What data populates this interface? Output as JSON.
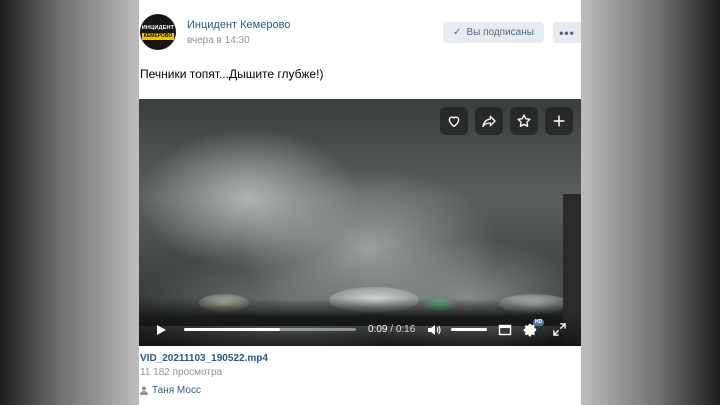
{
  "post": {
    "author": "Инцидент Кемерово",
    "avatar_line1": "ИНЦИДЕНТ",
    "avatar_line2": "КЕМЕРОВО",
    "time": "вчера в 14:30",
    "subscribe_label": "Вы подписаны",
    "more_label": "•••",
    "text": "Печники топят...Дышите глубже!)"
  },
  "video": {
    "current_time": "0:09",
    "separator": " / ",
    "duration": "0:16",
    "progress_fraction": 0.56,
    "volume_fraction": 1.0,
    "quality_badge": "HD",
    "top_controls": [
      "heart-icon",
      "share-icon",
      "star-icon",
      "plus-icon"
    ],
    "bottom_controls": [
      "play-icon",
      "volume-icon",
      "miniplayer-icon",
      "gear-icon",
      "fullscreen-icon"
    ]
  },
  "attachment": {
    "file_name": "VID_20211103_190522.mp4",
    "views": "11 182 просмотра",
    "uploader": "Таня Мосс"
  },
  "colors": {
    "link": "#2a5885",
    "muted": "#939393",
    "button_bg": "#e5ebf1",
    "button_text": "#55677d"
  }
}
